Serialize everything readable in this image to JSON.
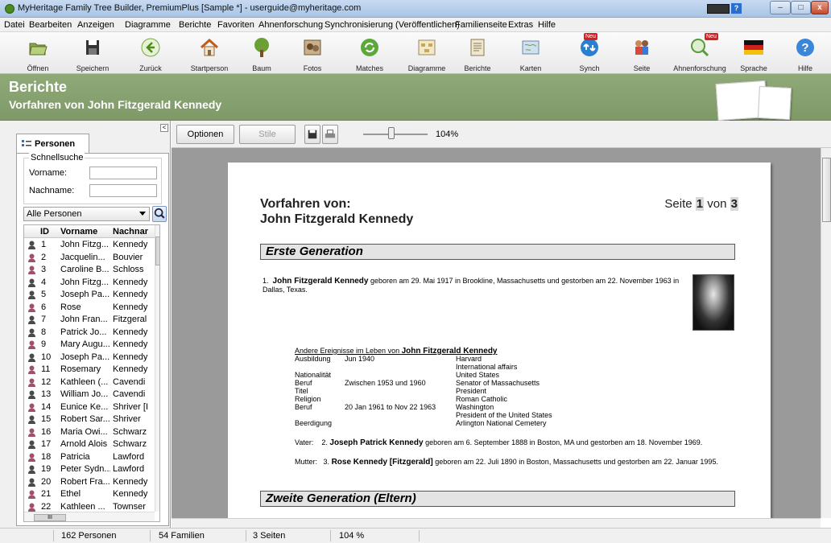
{
  "window": {
    "title": "MyHeritage Family Tree Builder, PremiumPlus [Sample *] - userguide@myheritage.com",
    "controls": {
      "minimize": "–",
      "maximize": "□",
      "close": "x"
    }
  },
  "menu": [
    "Datei",
    "Bearbeiten",
    "Anzeigen",
    "Diagramme",
    "Berichte",
    "Favoriten",
    "Ahnenforschung",
    "Synchronisierung (Veröffentlichen)",
    "Familienseite",
    "Extras",
    "Hilfe"
  ],
  "toolbar": {
    "buttons": [
      {
        "label": "Öffnen",
        "icon": "open-folder-icon"
      },
      {
        "label": "Speichern",
        "icon": "save-icon"
      },
      {
        "label": "Zurück",
        "icon": "back-arrow-icon"
      },
      {
        "label": "Startperson",
        "icon": "home-icon"
      },
      {
        "label": "Baum",
        "icon": "tree-icon"
      },
      {
        "label": "Fotos",
        "icon": "photos-icon"
      },
      {
        "label": "Matches",
        "icon": "matches-icon"
      },
      {
        "label": "Diagramme",
        "icon": "charts-icon"
      },
      {
        "label": "Berichte",
        "icon": "reports-icon"
      },
      {
        "label": "Karten",
        "icon": "map-icon"
      },
      {
        "label": "Synch",
        "icon": "sync-icon",
        "badge": "Neu"
      },
      {
        "label": "Seite",
        "icon": "family-site-icon"
      },
      {
        "label": "Ahnenforschung",
        "icon": "research-icon",
        "badge": "Neu"
      },
      {
        "label": "Sprache",
        "icon": "german-flag-icon"
      },
      {
        "label": "Hilfe",
        "icon": "help-icon"
      }
    ]
  },
  "banner": {
    "title": "Berichte",
    "subtitle": "Vorfahren von John Fitzgerald Kennedy"
  },
  "left_panel": {
    "collapse_glyph": "<",
    "tab_label": "Personen",
    "quick_search": {
      "title": "Schnellsuche",
      "first_name_label": "Vorname:",
      "last_name_label": "Nachname:"
    },
    "filter": "Alle Personen",
    "columns": [
      "ID",
      "Vorname",
      "Nachnar"
    ],
    "scroll_glyph": "III",
    "rows": [
      {
        "id": "1",
        "first": "John Fitzg...",
        "last": "Kennedy",
        "gender": "m"
      },
      {
        "id": "2",
        "first": "Jacquelin...",
        "last": "Bouvier",
        "gender": "f"
      },
      {
        "id": "3",
        "first": "Caroline B...",
        "last": "Schloss",
        "gender": "f"
      },
      {
        "id": "4",
        "first": "John Fitzg...",
        "last": "Kennedy",
        "gender": "m"
      },
      {
        "id": "5",
        "first": "Joseph Pa...",
        "last": "Kennedy",
        "gender": "m"
      },
      {
        "id": "6",
        "first": "Rose",
        "last": "Kennedy",
        "gender": "f"
      },
      {
        "id": "7",
        "first": "John Fran...",
        "last": "Fitzgeral",
        "gender": "m"
      },
      {
        "id": "8",
        "first": "Patrick Jo...",
        "last": "Kennedy",
        "gender": "m"
      },
      {
        "id": "9",
        "first": "Mary Augu...",
        "last": "Kennedy",
        "gender": "f"
      },
      {
        "id": "10",
        "first": "Joseph Pa...",
        "last": "Kennedy",
        "gender": "m"
      },
      {
        "id": "11",
        "first": "Rosemary",
        "last": "Kennedy",
        "gender": "f"
      },
      {
        "id": "12",
        "first": "Kathleen (...",
        "last": "Cavendi",
        "gender": "f"
      },
      {
        "id": "13",
        "first": "William Jo...",
        "last": "Cavendi",
        "gender": "m"
      },
      {
        "id": "14",
        "first": "Eunice Ke...",
        "last": "Shriver [I",
        "gender": "f"
      },
      {
        "id": "15",
        "first": "Robert Sar...",
        "last": "Shriver",
        "gender": "m"
      },
      {
        "id": "16",
        "first": "Maria Owi...",
        "last": "Schwarz",
        "gender": "f"
      },
      {
        "id": "17",
        "first": "Arnold Alois",
        "last": "Schwarz",
        "gender": "m"
      },
      {
        "id": "18",
        "first": "Patricia",
        "last": "Lawford",
        "gender": "f"
      },
      {
        "id": "19",
        "first": "Peter Sydn...",
        "last": "Lawford",
        "gender": "m"
      },
      {
        "id": "20",
        "first": "Robert Fra...",
        "last": "Kennedy",
        "gender": "m"
      },
      {
        "id": "21",
        "first": "Ethel",
        "last": "Kennedy",
        "gender": "f"
      },
      {
        "id": "22",
        "first": "Kathleen ...",
        "last": "Townser",
        "gender": "f"
      }
    ]
  },
  "report_toolbar": {
    "options_label": "Optionen",
    "styles_label": "Stile",
    "zoom": "104%"
  },
  "report": {
    "title_line1": "Vorfahren von:",
    "title_line2": "John Fitzgerald Kennedy",
    "page_word": "Seite",
    "page_current": "1",
    "page_of": "von",
    "page_total": "3",
    "gen1_header": "Erste Generation",
    "gen2_header": "Zweite Generation (Eltern)",
    "person": {
      "number": "1.",
      "name": "John Fitzgerald Kennedy",
      "text": "geboren am 29. Mai 1917 in Brookline, Massachusetts und gestorben am 22. November 1963 in Dallas, Texas."
    },
    "events_title_prefix": "Andere Ereignisse im Leben von",
    "events_title_name": "John Fitzgerald Kennedy",
    "events": [
      {
        "type": "Ausbildung",
        "date": "Jun 1940",
        "value": "Harvard"
      },
      {
        "type": "",
        "date": "",
        "value": "International affairs"
      },
      {
        "type": "Nationalität",
        "date": "",
        "value": "United States"
      },
      {
        "type": "Beruf",
        "date": "Zwischen 1953 und 1960",
        "value": "Senator of Massachusetts"
      },
      {
        "type": "Titel",
        "date": "",
        "value": "President"
      },
      {
        "type": "Religion",
        "date": "",
        "value": "Roman Catholic"
      },
      {
        "type": "Beruf",
        "date": "20 Jan 1961 to Nov 22 1963",
        "value": "Washington"
      },
      {
        "type": "",
        "date": "",
        "value": "President of the United States"
      },
      {
        "type": "Beerdigung",
        "date": "",
        "value": "Arlington National Cemetery"
      }
    ],
    "father": {
      "label": "Vater:",
      "number": "2.",
      "name": "Joseph Patrick Kennedy",
      "text": "geboren am 6. September 1888 in Boston, MA und gestorben am 18. November 1969."
    },
    "mother": {
      "label": "Mutter:",
      "number": "3.",
      "name": "Rose Kennedy [Fitzgerald]",
      "text": "geboren am 22. Juli 1890 in Boston, Massachusetts und gestorben am 22. Januar 1995."
    }
  },
  "status": {
    "persons": "162 Personen",
    "families": "54 Familien",
    "pages": "3 Seiten",
    "zoom": "104 %"
  }
}
